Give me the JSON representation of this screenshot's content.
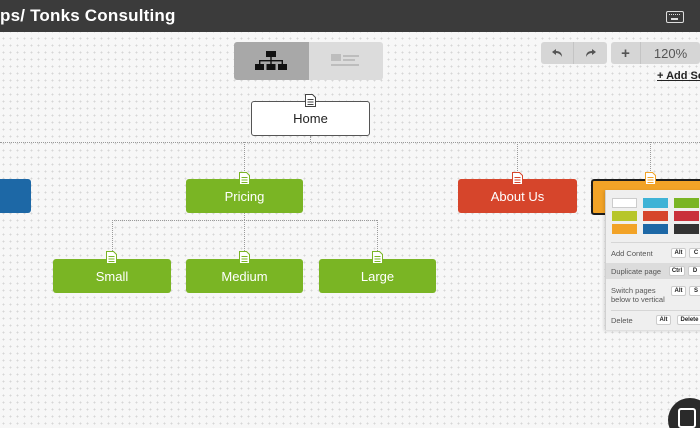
{
  "header": {
    "title": "ps/ Tonks Consulting",
    "keyboard_icon": "keyboard-icon"
  },
  "view_toggle": {
    "selected": "tree",
    "items": [
      {
        "name": "tree",
        "icon": "sitemap-icon"
      },
      {
        "name": "list",
        "icon": "list-icon"
      }
    ]
  },
  "toolbar": {
    "undo_icon": "undo-icon",
    "redo_icon": "redo-icon",
    "zoom_in_label": "+",
    "zoom_level": "120%",
    "add_section_label": "+ Add Se"
  },
  "sitemap": {
    "home": "Home",
    "level1": [
      "",
      "Pricing",
      "About Us",
      ""
    ],
    "level2": [
      "Small",
      "Medium",
      "Large"
    ]
  },
  "colors": {
    "green": "#7ab524",
    "red": "#d6452b",
    "blue": "#1d68a6",
    "orange": "#f2a327",
    "swatches": [
      "#ffffff",
      "#3fb3d6",
      "#7ab524",
      "#b7c62a",
      "#d6452b",
      "#c9313b",
      "#f2a327",
      "#1d68a6",
      "#333333"
    ]
  },
  "popover": {
    "add_content": {
      "label": "Add Content",
      "keys": [
        "Alt",
        "C"
      ]
    },
    "duplicate_page": {
      "label": "Duplicate page",
      "keys": [
        "Ctrl",
        "D"
      ]
    },
    "switch_pages": {
      "label_line1": "Switch pages",
      "label_line2": "below to vertical",
      "keys": [
        "Alt",
        "S"
      ]
    },
    "delete": {
      "label": "Delete",
      "keys": [
        "Alt",
        "Delete"
      ]
    }
  }
}
